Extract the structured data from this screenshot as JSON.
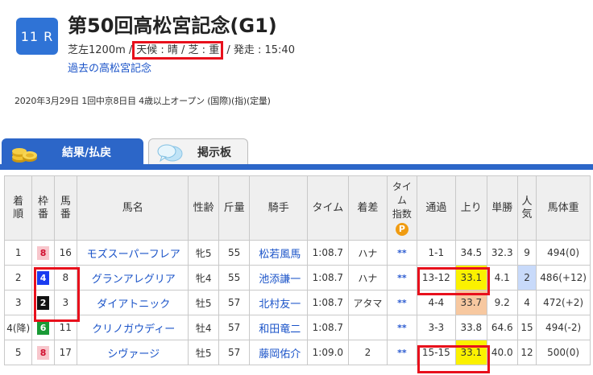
{
  "race": {
    "number": "11 R",
    "title": "第50回高松宮記念(G1)",
    "course": "芝左1200m /",
    "weather_condition": "天候 : 晴 / 芝 : 重",
    "start_time": "/ 発走 : 15:40",
    "past_link": "過去の高松宮記念",
    "meta": "2020年3月29日 1回中京8日目 4歳以上オープン (国際)(指)(定量)"
  },
  "tabs": [
    {
      "label": "結果/払戻",
      "icon": "coins-icon",
      "active": true
    },
    {
      "label": "掲示板",
      "icon": "chat-bubble-icon",
      "active": false
    }
  ],
  "table": {
    "headers": {
      "rank": "着\n順",
      "waku": "枠\n番",
      "umaban": "馬\n番",
      "horse": "馬名",
      "sex_age": "性齢",
      "weight": "斤量",
      "jockey": "騎手",
      "time": "タイム",
      "margin": "着差",
      "time_index": "タイム\n指数",
      "passing": "通過",
      "last3f": "上り",
      "odds": "単勝",
      "popularity": "人\n気",
      "body_weight": "馬体重"
    },
    "p_badge": "P",
    "rows": [
      {
        "rank": "1",
        "waku": "8",
        "umaban": "16",
        "horse": "モズスーパーフレア",
        "sex_age": "牝5",
        "weight": "55",
        "jockey": "松若風馬",
        "time": "1:08.7",
        "margin": "ハナ",
        "time_index": "**",
        "passing": "1-1",
        "last3f": "34.5",
        "odds": "32.3",
        "popularity": "9",
        "body_weight": "494(0)"
      },
      {
        "rank": "2",
        "waku": "4",
        "umaban": "8",
        "horse": "グランアレグリア",
        "sex_age": "牝4",
        "weight": "55",
        "jockey": "池添謙一",
        "time": "1:08.7",
        "margin": "ハナ",
        "time_index": "**",
        "passing": "13-12",
        "last3f": "33.1",
        "odds": "4.1",
        "popularity": "2",
        "body_weight": "486(+12)"
      },
      {
        "rank": "3",
        "waku": "2",
        "umaban": "3",
        "horse": "ダイアトニック",
        "sex_age": "牡5",
        "weight": "57",
        "jockey": "北村友一",
        "time": "1:08.7",
        "margin": "アタマ",
        "time_index": "**",
        "passing": "4-4",
        "last3f": "33.7",
        "odds": "9.2",
        "popularity": "4",
        "body_weight": "472(+2)"
      },
      {
        "rank": "4(降)",
        "waku": "6",
        "umaban": "11",
        "horse": "クリノガウディー",
        "sex_age": "牡4",
        "weight": "57",
        "jockey": "和田竜二",
        "time": "1:08.7",
        "margin": "",
        "time_index": "**",
        "passing": "3-3",
        "last3f": "33.8",
        "odds": "64.6",
        "popularity": "15",
        "body_weight": "494(-2)"
      },
      {
        "rank": "5",
        "waku": "8",
        "umaban": "17",
        "horse": "シヴァージ",
        "sex_age": "牡5",
        "weight": "57",
        "jockey": "藤岡佑介",
        "time": "1:09.0",
        "margin": "2",
        "time_index": "**",
        "passing": "15-15",
        "last3f": "33.1",
        "odds": "40.0",
        "popularity": "12",
        "body_weight": "500(0)"
      }
    ]
  },
  "colors": {
    "accent_blue": "#2c66c8",
    "highlight_red": "#e8101c",
    "last3f_top": "#fbf100",
    "last3f_second": "#f7c8a0",
    "popularity_blue": "#c8dafa",
    "waku_8": "#f8c6cc",
    "waku_4": "#1a3cf0",
    "waku_2": "#111111",
    "waku_6": "#1a9a36"
  }
}
